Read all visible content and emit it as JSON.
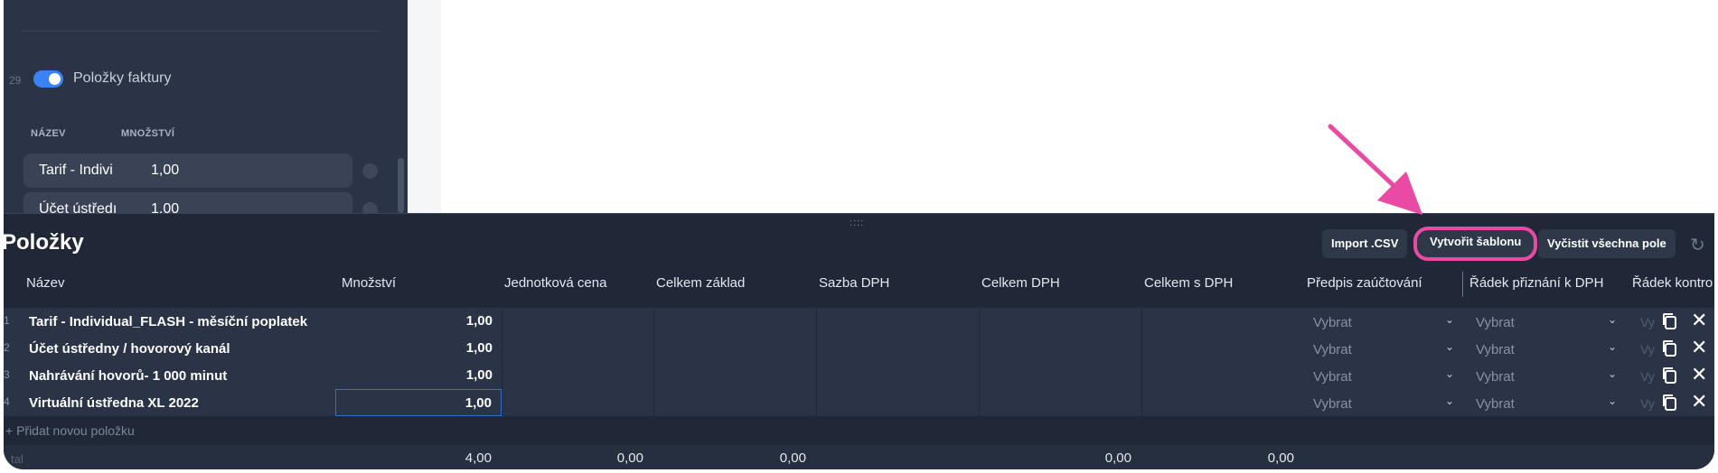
{
  "form": {
    "row_number": "29",
    "toggle_label": "Položky faktury",
    "columns": {
      "name": "NÁZEV",
      "quantity": "MNOŽSTVÍ"
    },
    "rows": [
      {
        "name": "Tarif - Indivi",
        "quantity": "1,00"
      },
      {
        "name": "Účet ústředı",
        "quantity": "1,00"
      }
    ]
  },
  "panel": {
    "drag_handle": "::::",
    "title": "Položky",
    "buttons": {
      "import": "Import .CSV",
      "template": "Vytvořit šablonu",
      "clear": "Vyčistit všechna pole"
    },
    "headers": [
      "Název",
      "Množství",
      "Jednotková cena",
      "Celkem základ",
      "Sazba DPH",
      "Celkem DPH",
      "Celkem s DPH",
      "Předpis zaúčtování",
      "Řádek přiznání k DPH",
      "Řádek kontro"
    ],
    "rows": [
      {
        "idx": "1",
        "name": "Tarif - Individual_FLASH - měsíční poplatek",
        "quantity": "1,00",
        "posting": "Vybrat",
        "vat_line": "Vybrat",
        "control": "Vy"
      },
      {
        "idx": "2",
        "name": "Účet ústředny / hovorový kanál",
        "quantity": "1,00",
        "posting": "Vybrat",
        "vat_line": "Vybrat",
        "control": "Vy"
      },
      {
        "idx": "3",
        "name": "Nahrávání hovorů- 1 000 minut",
        "quantity": "1,00",
        "posting": "Vybrat",
        "vat_line": "Vybrat",
        "control": "Vy"
      },
      {
        "idx": "4",
        "name": "Virtuální ústředna XL 2022",
        "quantity": "1,00",
        "posting": "Vybrat",
        "vat_line": "Vybrat",
        "control": "Vy"
      }
    ],
    "add_item": "+ Přidat novou položku",
    "totals": {
      "label": "tal",
      "quantity": "4,00",
      "unit_price": "0,00",
      "base": "0,00",
      "vat": "0,00",
      "with_vat": "0,00"
    }
  },
  "colors": {
    "accent": "#3b82f6",
    "highlight": "#e94aa3",
    "panel_bg": "#202838"
  },
  "icons": [
    "copy-icon",
    "close-icon",
    "refresh-icon",
    "chevron-down-icon",
    "annotation-arrow-icon"
  ]
}
